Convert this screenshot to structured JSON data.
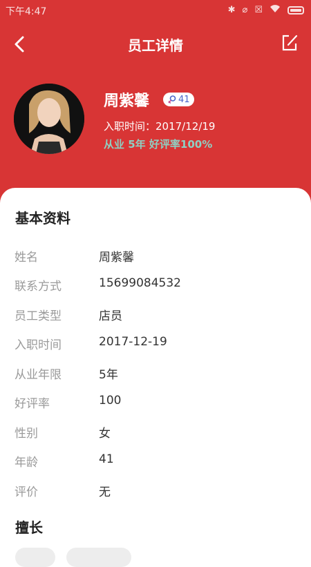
{
  "status_bar": {
    "time": "下午4:47"
  },
  "nav": {
    "title": "员工详情"
  },
  "profile": {
    "name": "周紫馨",
    "age_badge": "41",
    "hire_line": "入职时间：2017/12/19",
    "exp_line": "从业 5年  好评率100%"
  },
  "basic_info": {
    "title": "基本资料",
    "rows": [
      {
        "label": "姓名",
        "value": "周紫馨"
      },
      {
        "label": "联系方式",
        "value": "15699084532"
      },
      {
        "label": "员工类型",
        "value": "店员"
      },
      {
        "label": "入职时间",
        "value": "2017-12-19"
      },
      {
        "label": "从业年限",
        "value": "5年"
      },
      {
        "label": "好评率",
        "value": "100"
      },
      {
        "label": "性别",
        "value": "女"
      },
      {
        "label": "年龄",
        "value": "41"
      },
      {
        "label": "评价",
        "value": "无"
      }
    ]
  },
  "specialties": {
    "title": "擅长"
  },
  "colors": {
    "brand_red": "#d83535",
    "accent_teal": "#8fd0c3",
    "badge_blue": "#4a66c9"
  }
}
